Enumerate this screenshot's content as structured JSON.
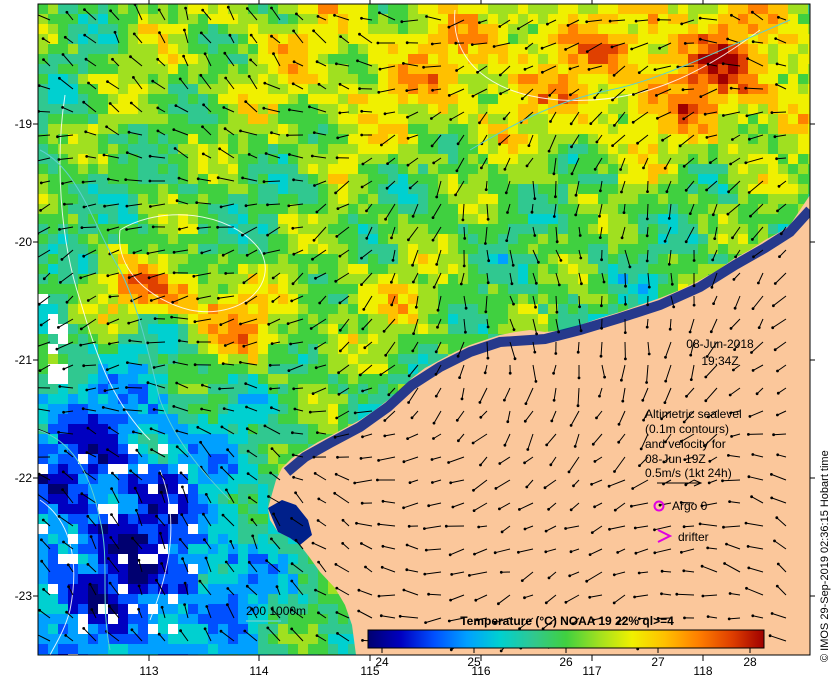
{
  "map": {
    "lon_ticks": [
      "113",
      "114",
      "115",
      "116",
      "117",
      "118"
    ],
    "lat_ticks": [
      "-19",
      "-20",
      "-21",
      "-22",
      "-23"
    ],
    "date_line": "08-Jun-2018",
    "time_line": "19:34Z",
    "altimetry_lines": [
      "Altimetric sealevel",
      "(0.1m contours)",
      "and velocity for",
      "08-Jun 19Z",
      "0.5m/s (1kt 24h)"
    ],
    "argo_label": "Argo 0",
    "drifter_label": "drifter",
    "depth_label": "200  1000m",
    "copyright": "© IMOS 29-Sep-2019 02:36:15 Hobart time",
    "colorbar": {
      "title": "Temperature (°C) NOAA 19 22% ql>=4",
      "ticks": [
        "24",
        "25",
        "26",
        "27",
        "28"
      ]
    }
  },
  "colors": {
    "land": "#fbc79b",
    "argo": "#e000e0",
    "drifter": "#e000e0",
    "isobath": "#5ed0d0",
    "contour": "#ffffff",
    "palette": [
      "#000070",
      "#0000c0",
      "#0050ff",
      "#00a0ff",
      "#00d0d0",
      "#30c890",
      "#40d040",
      "#a0e020",
      "#f0f000",
      "#ffc000",
      "#ff8000",
      "#e04000",
      "#a00000"
    ]
  }
}
